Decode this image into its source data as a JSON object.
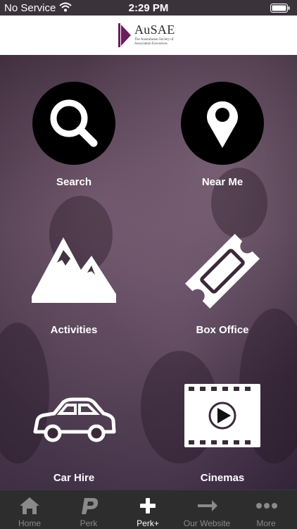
{
  "status_bar": {
    "carrier": "No Service",
    "time": "2:29 PM"
  },
  "header": {
    "logo_brand": "AuSAE",
    "logo_tagline": "The Australasian Society of Association Executives",
    "brand_color": "#6b1d5c"
  },
  "grid": {
    "tiles": [
      {
        "label": "Search",
        "icon": "search-icon"
      },
      {
        "label": "Near Me",
        "icon": "location-pin-icon"
      },
      {
        "label": "Activities",
        "icon": "mountain-icon"
      },
      {
        "label": "Box Office",
        "icon": "ticket-icon"
      },
      {
        "label": "Car Hire",
        "icon": "car-icon"
      },
      {
        "label": "Cinemas",
        "icon": "film-icon"
      }
    ]
  },
  "tab_bar": {
    "items": [
      {
        "label": "Home",
        "icon": "home-icon",
        "active": false
      },
      {
        "label": "Perk",
        "icon": "perk-logo-icon",
        "active": false
      },
      {
        "label": "Perk+",
        "icon": "plus-icon",
        "active": true
      },
      {
        "label": "Our Website",
        "icon": "arrow-right-icon",
        "active": false
      },
      {
        "label": "More",
        "icon": "more-dots-icon",
        "active": false
      }
    ]
  }
}
